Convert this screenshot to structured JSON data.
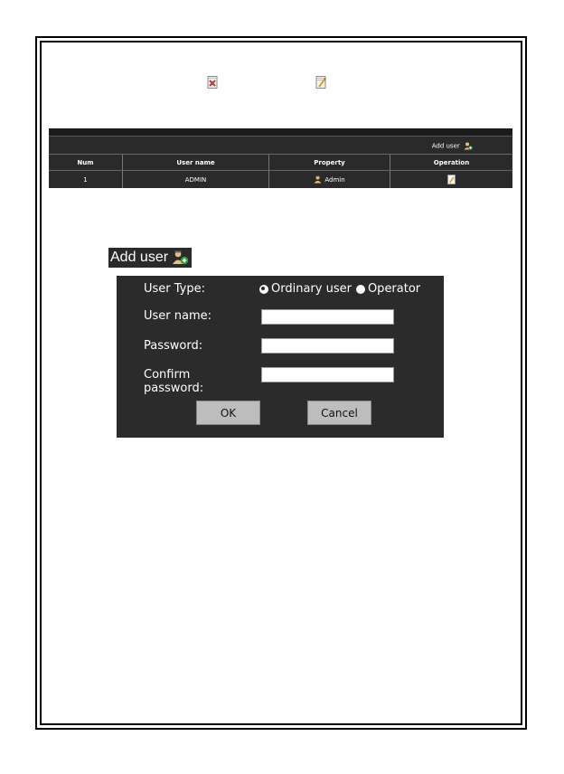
{
  "top_icons": [
    {
      "icon": "delete-icon",
      "color": "#c0392b"
    },
    {
      "icon": "edit-icon",
      "color": "#e0a020"
    }
  ],
  "user_table": {
    "add_user_link": "Add user",
    "columns": [
      "Num",
      "User name",
      "Property",
      "Operation"
    ],
    "rows": [
      {
        "num": "1",
        "user_name": "ADMIN",
        "property": "Admin",
        "property_icon": "admin-user-icon",
        "operation_icon": "edit-icon"
      }
    ]
  },
  "add_user_section": {
    "title": "Add user",
    "icon": "add-user-icon",
    "user_type_label": "User Type:",
    "user_type_options": [
      {
        "label": "Ordinary user",
        "selected": true
      },
      {
        "label": "Operator",
        "selected": false
      }
    ],
    "username_label": "User name:",
    "username_value": "",
    "password_label": "Password:",
    "password_value": "",
    "confirm_label_line1": "Confirm",
    "confirm_label_line2": "password:",
    "confirm_value": "",
    "ok_label": "OK",
    "cancel_label": "Cancel"
  },
  "colors": {
    "panel_bg": "#2b2b2b",
    "text": "#ffffff",
    "button_bg": "#bdbdbd"
  }
}
